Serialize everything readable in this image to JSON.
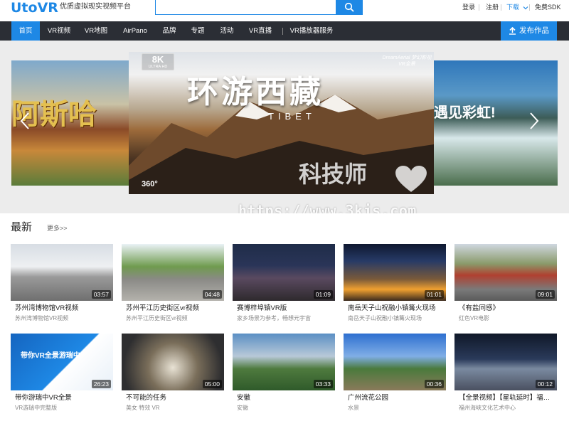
{
  "header": {
    "logo": "UtoVR",
    "slogan": "优质虚拟现实视频平台",
    "login": "登录",
    "register": "注册",
    "download": "下载",
    "sdk": "免费SDK"
  },
  "nav": {
    "items": [
      "首页",
      "VR视频",
      "VR地图",
      "AirPano",
      "品牌",
      "专题",
      "活动",
      "VR直播",
      "VR播放器服务"
    ],
    "active_index": 0,
    "publish": "发布作品"
  },
  "banner": {
    "left_text": "阿斯哈",
    "right_text": "遇见彩虹!",
    "main_title": "环游西藏",
    "main_subtitle": "TIBET",
    "badge_8k": "8K",
    "badge_ultra": "ULTRA HD",
    "brand": "DreamAerial 梦幻影视VR全景",
    "badge_360": "360°"
  },
  "watermark": {
    "text": "科技师",
    "url": "https://www.3kjs.com"
  },
  "section": {
    "title": "最新",
    "more": "更多>>"
  },
  "cards": [
    {
      "title": "苏州湾博物馆VR视频",
      "desc": "苏州湾博物馆VR视频",
      "duration": "03:57"
    },
    {
      "title": "苏州平江历史街区vr视频",
      "desc": "苏州平江历史街区vr视频",
      "duration": "04:48"
    },
    {
      "title": "赛博梓埠镇VR版",
      "desc": "家乡场景为参考，畅想元宇宙",
      "duration": "01:09"
    },
    {
      "title": "南岳天子山祝融小镇篝火现场",
      "desc": "南岳天子山祝融小镇篝火现场",
      "duration": "01:01"
    },
    {
      "title": "《有盐同感》",
      "desc": "红色VR电影",
      "duration": "09:01"
    },
    {
      "title": "带你游瑞中VR全景",
      "desc": "VR游瑞中完整版",
      "duration": "26:23",
      "thumb_text": "带你VR全景游瑞中"
    },
    {
      "title": "不可能的任务",
      "desc": "美女 特效 VR",
      "duration": "05:00"
    },
    {
      "title": "安徽",
      "desc": "安徽",
      "duration": "03:33"
    },
    {
      "title": "广州流花公园",
      "desc": "水景",
      "duration": "00:36"
    },
    {
      "title": "【全景视频】【星轨延时】福…",
      "desc": "福州海峡文化艺术中心",
      "duration": "00:12"
    }
  ],
  "colors": {
    "brand": "#1e88e5",
    "nav_bg": "#2b2e35",
    "page_bg": "#f1f1f1"
  }
}
